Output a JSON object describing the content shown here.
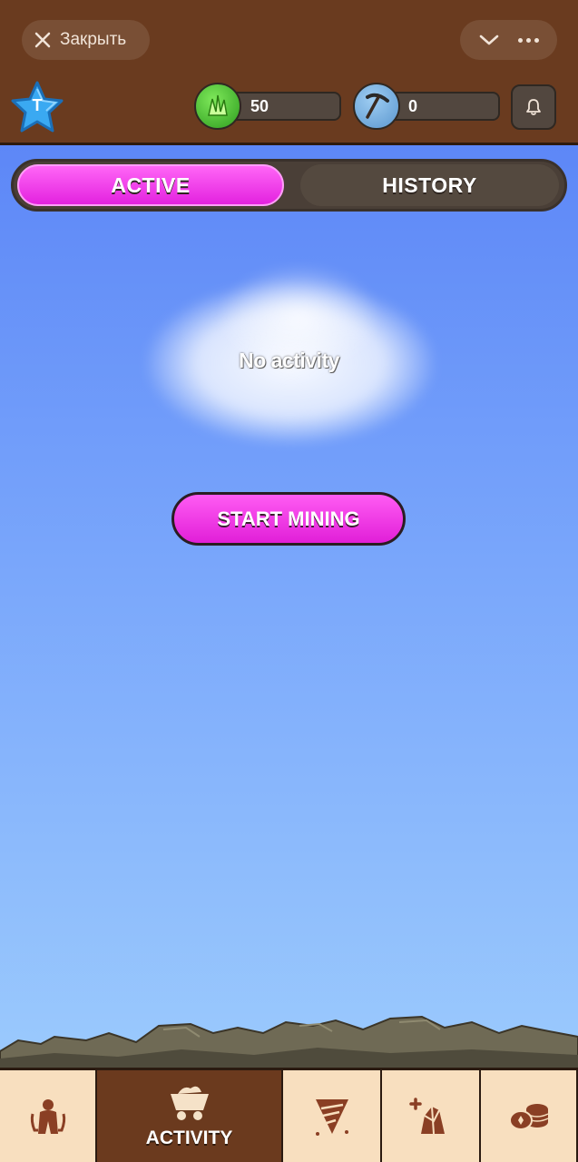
{
  "header": {
    "close_label": "Закрыть",
    "avatar_letter": "T",
    "gems_value": "50",
    "picks_value": "0"
  },
  "tabs": {
    "active_label": "ACTIVE",
    "history_label": "HISTORY",
    "selected": "ACTIVE"
  },
  "main": {
    "empty_text": "No activity",
    "start_button_label": "START MINING"
  },
  "bottom_nav": {
    "items": [
      {
        "icon": "team-icon",
        "label": ""
      },
      {
        "icon": "mine-cart-icon",
        "label": "ACTIVITY",
        "active": true
      },
      {
        "icon": "drill-icon",
        "label": ""
      },
      {
        "icon": "crystal-upgrade-icon",
        "label": ""
      },
      {
        "icon": "coins-icon",
        "label": ""
      }
    ]
  },
  "colors": {
    "header_bg": "#6a3b1f",
    "accent_pink": "#e322df",
    "nav_bg": "#f8dfbf",
    "nav_active_bg": "#6b3a1e",
    "icon_brown": "#8a3f24"
  }
}
